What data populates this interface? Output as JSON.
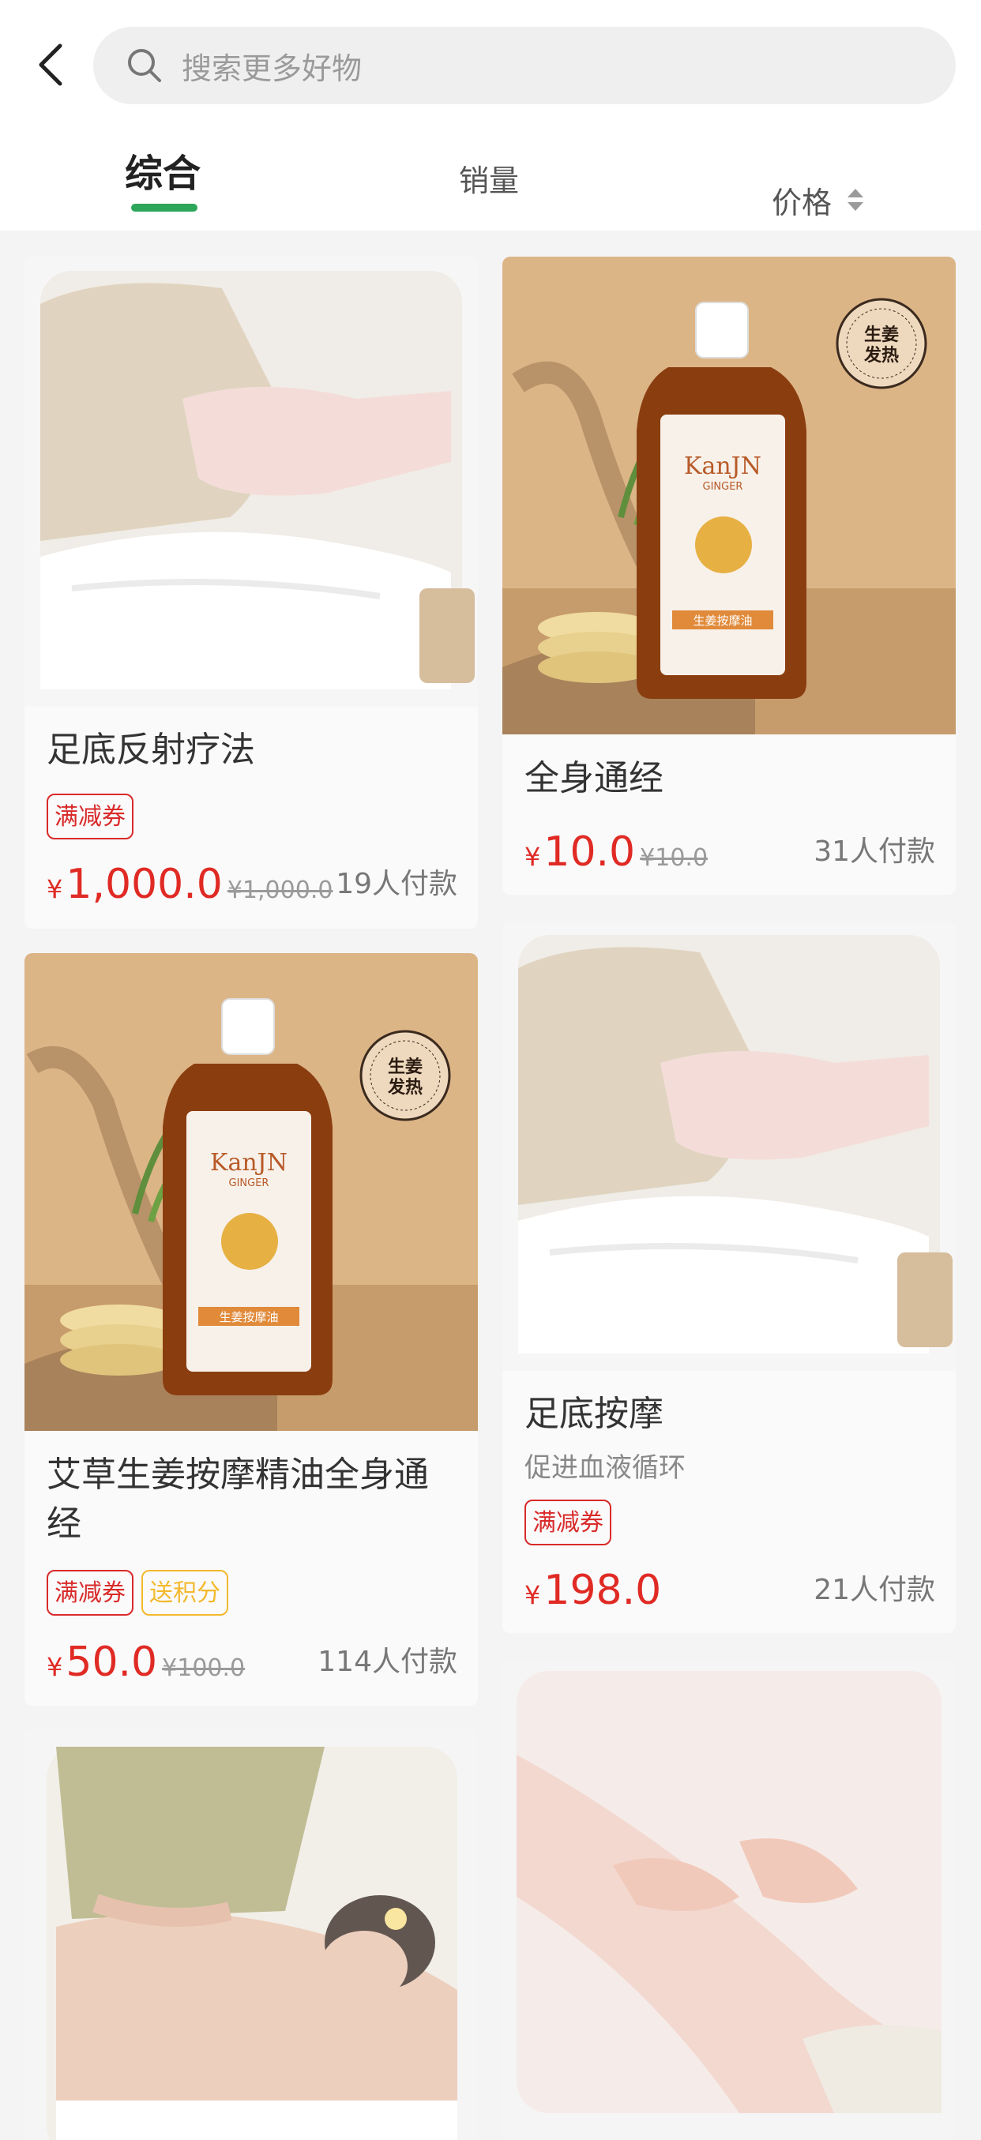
{
  "header": {
    "back_icon": "chevron-left-icon",
    "search": {
      "placeholder": "搜索更多好物",
      "icon": "search-icon"
    }
  },
  "tabs": [
    {
      "label": "综合",
      "active": true
    },
    {
      "label": "销量",
      "active": false
    },
    {
      "label": "价格",
      "active": false,
      "icon": "sort-icon"
    }
  ],
  "colors": {
    "accent": "#2ea65a",
    "price": "#e02a24",
    "tag_red": "#d92a2a",
    "tag_yellow": "#f3b92c"
  },
  "products": [
    {
      "title": "足底反射疗法",
      "tags": [
        "满减券"
      ],
      "currency": "¥",
      "price": "1,000.0",
      "original_price": "¥1,000.0",
      "buyers": "19人付款",
      "image": "foot-massage-photo"
    },
    {
      "title": "全身通经",
      "tags": [],
      "currency": "¥",
      "price": "10.0",
      "original_price": "¥10.0",
      "buyers": "31人付款",
      "image": "ginger-oil-bottle-photo",
      "bottle_brand": "KanJN",
      "bottle_sub": "GINGER",
      "bottle_label": "生姜按摩油",
      "badge_line1": "生姜",
      "badge_line2": "发热"
    },
    {
      "title": "艾草生姜按摩精油全身通经",
      "tags": [
        "满减券",
        "送积分"
      ],
      "currency": "¥",
      "price": "50.0",
      "original_price": "¥100.0",
      "buyers": "114人付款",
      "image": "ginger-oil-bottle-photo",
      "bottle_brand": "KanJN",
      "bottle_sub": "GINGER",
      "bottle_label": "生姜按摩油",
      "badge_line1": "生姜",
      "badge_line2": "发热"
    },
    {
      "title": "足底按摩",
      "subtitle": "促进血液循环",
      "tags": [
        "满减券"
      ],
      "currency": "¥",
      "price": "198.0",
      "buyers": "21人付款",
      "image": "foot-massage-photo"
    },
    {
      "image": "back-massage-photo"
    },
    {
      "image": "leg-massage-photo"
    }
  ]
}
